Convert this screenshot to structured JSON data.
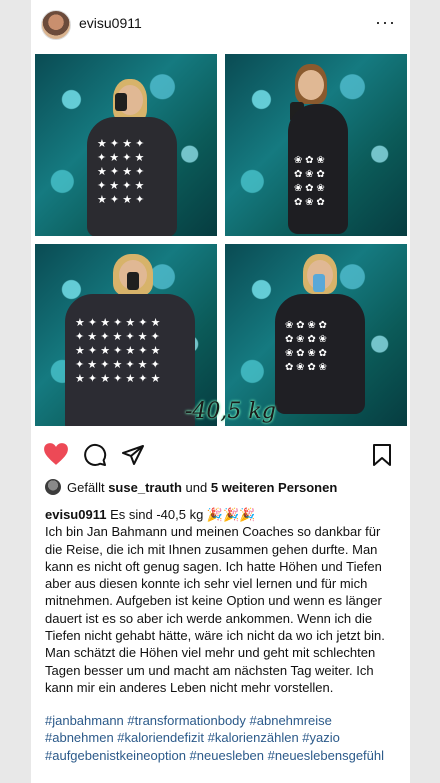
{
  "post": {
    "username": "evisu0911",
    "more_label": "···",
    "photo_overlay_text": "-40,5 kg"
  },
  "likes": {
    "prefix": "Gefällt",
    "user": "suse_trauth",
    "middle": "und",
    "others": "5 weiteren Personen"
  },
  "caption": {
    "username": "evisu0911",
    "first_line": "Es sind -40,5 kg 🎉🎉🎉",
    "body": "Ich bin Jan Bahmann und meinen Coaches so dankbar für die Reise, die ich mit Ihnen zusammen gehen durfte. Man kann es nicht oft genug sagen. Ich hatte Höhen und Tiefen aber aus diesen konnte ich sehr viel lernen und für mich mitnehmen. Aufgeben ist keine Option und wenn es länger dauert ist es so aber ich werde ankommen. Wenn ich die Tiefen nicht gehabt hätte, wäre ich nicht da wo ich jetzt bin. Man schätzt die Höhen viel mehr und geht mit schlechten Tagen besser um und macht am nächsten Tag weiter. Ich kann mir ein anderes Leben nicht mehr vorstellen."
  },
  "hashtags": "#janbahmann #transformationbody #abnehmreise #abnehmen #kaloriendefizit #kalorienzählen #yazio #aufgebenistkeineoption #neuesleben #neueslebensgefühl",
  "colors": {
    "heart": "#ed4956",
    "hashtag": "#2c5a8a"
  },
  "icons": [
    "heart-icon",
    "comment-icon",
    "share-icon",
    "bookmark-icon",
    "more-icon"
  ]
}
